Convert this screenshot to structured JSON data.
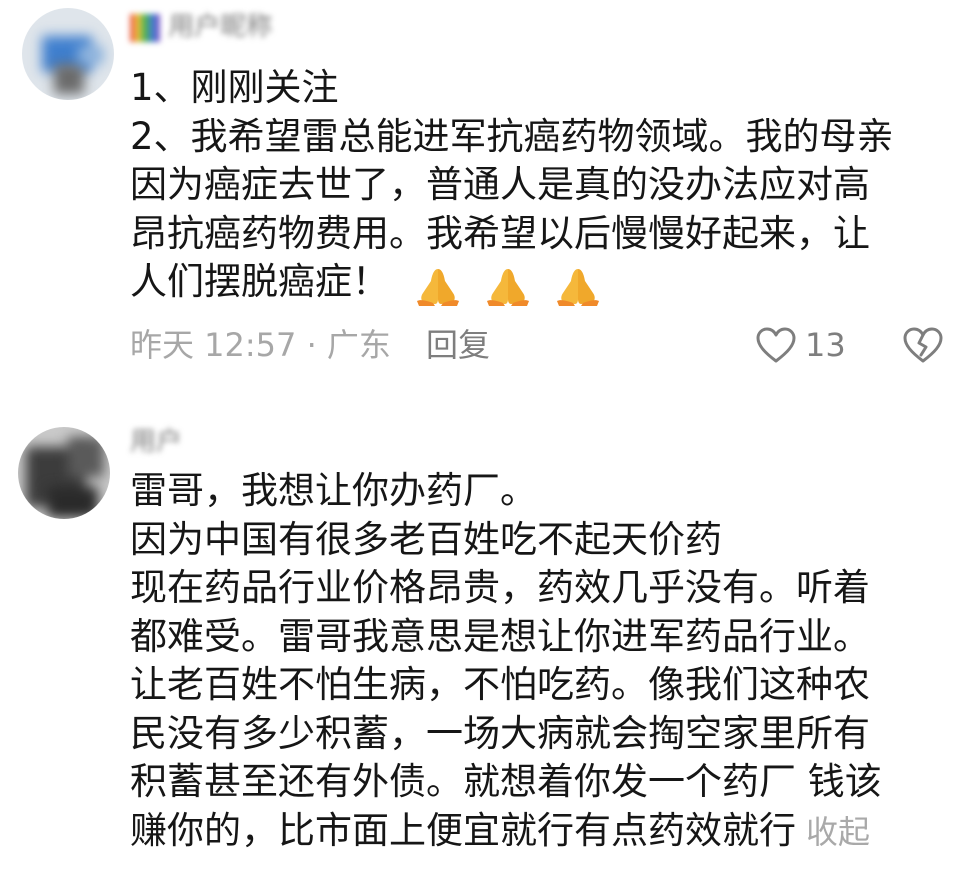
{
  "comments": [
    {
      "username": "用户昵称",
      "lines": [
        "1、刚刚关注",
        "2、我希望雷总能进军抗癌药物领域。我的母亲",
        "因为癌症去世了，普通人是真的没办法应对高",
        "昂抗癌药物费用。我希望以后慢慢好起来，让",
        "人们摆脱癌症！"
      ],
      "emoji": "🙏🙏🙏",
      "time": "昨天 12:57 · 广东",
      "reply_label": "回复",
      "like_count": "13"
    },
    {
      "username": "用户",
      "lines": [
        "雷哥，我想让你办药厂。",
        "因为中国有很多老百姓吃不起天价药",
        "现在药品行业价格昂贵，药效几乎没有。听着",
        "都难受。雷哥我意思是想让你进军药品行业。",
        "让老百姓不怕生病，不怕吃药。像我们这种农",
        "民没有多少积蓄，一场大病就会掏空家里所有",
        "积蓄甚至还有外债。就想着你发一个药厂 钱该",
        "赚你的，比市面上便宜就行有点药效就行"
      ],
      "collapse_label": "收起"
    }
  ],
  "icons": {
    "like": "heart-outline-icon",
    "dislike": "broken-heart-icon",
    "emoji": "folded-hands-emoji"
  },
  "colors": {
    "text": "#161616",
    "meta": "#a7a7a7",
    "action": "#7e7e7e",
    "collapse": "#a9a9a9",
    "emoji": "#f4b63a"
  }
}
